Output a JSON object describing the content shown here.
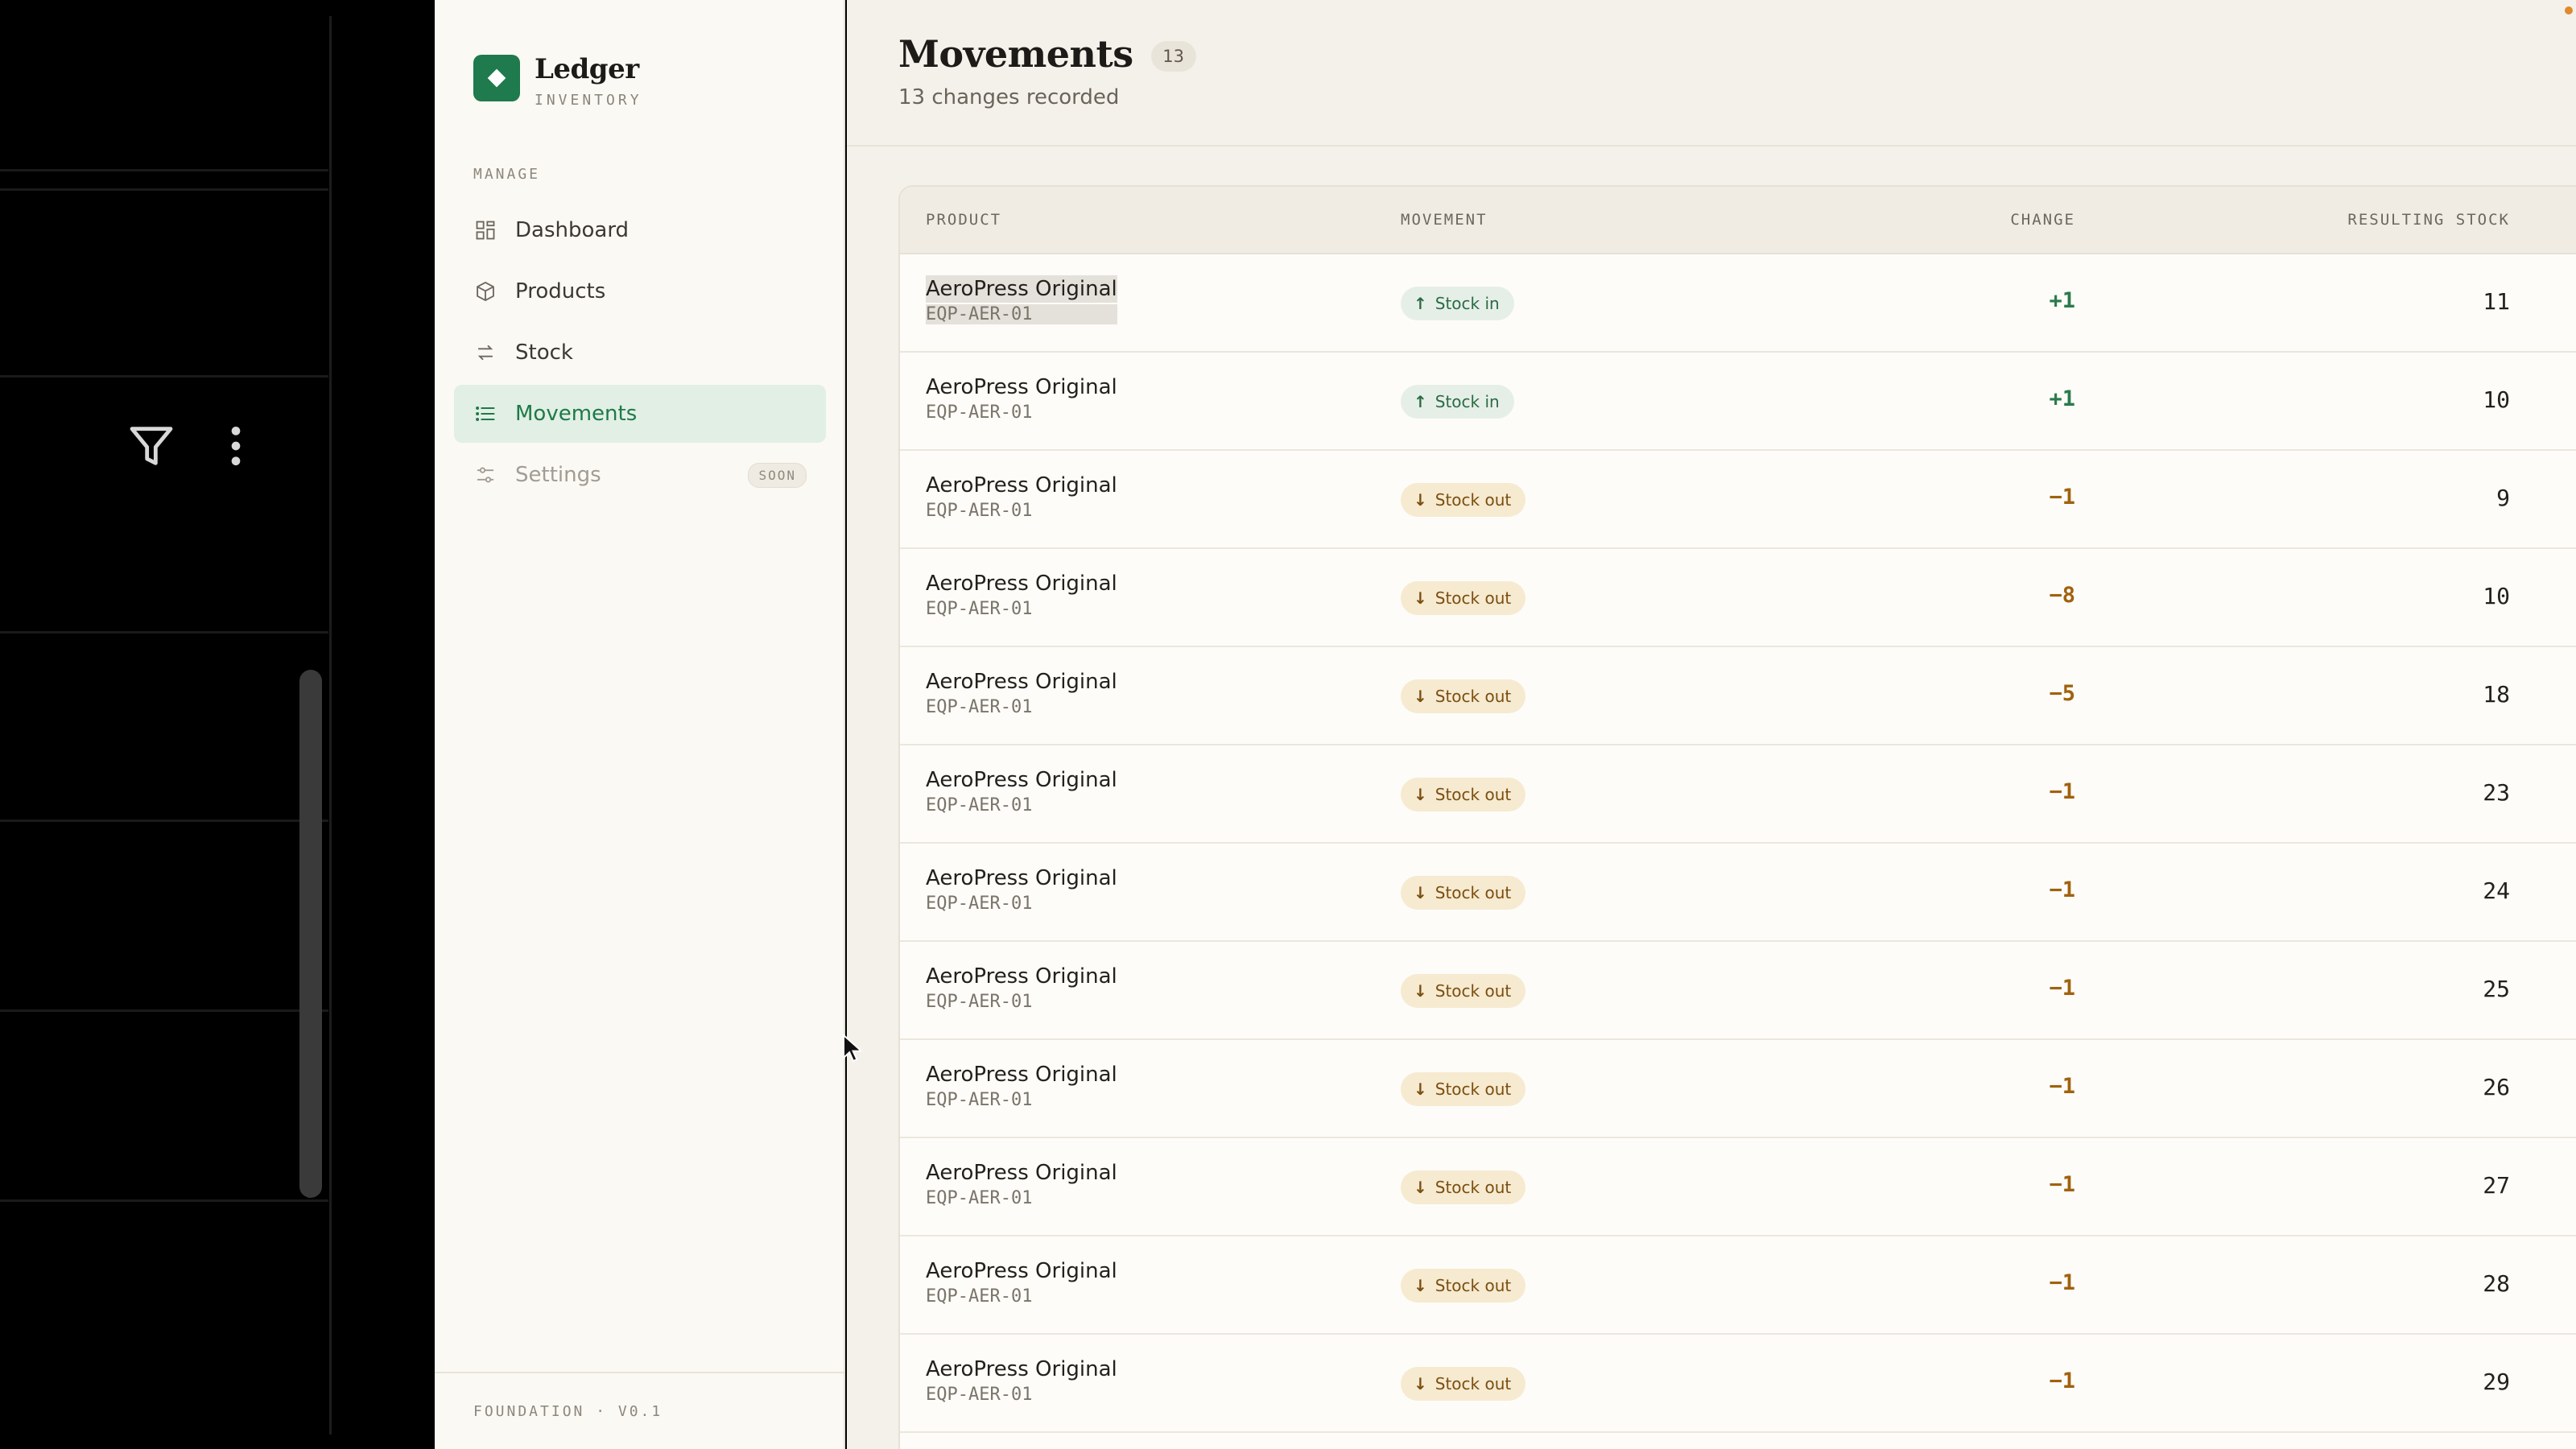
{
  "brand": {
    "name": "Ledger",
    "subtitle": "INVENTORY"
  },
  "sidebar": {
    "section_label": "MANAGE",
    "items": [
      {
        "label": "Dashboard",
        "icon": "grid-icon"
      },
      {
        "label": "Products",
        "icon": "box-icon"
      },
      {
        "label": "Stock",
        "icon": "arrows-icon"
      },
      {
        "label": "Movements",
        "icon": "list-icon",
        "active": true
      },
      {
        "label": "Settings",
        "icon": "sliders-icon",
        "badge": "SOON",
        "disabled": true
      }
    ],
    "footer": "FOUNDATION · V0.1"
  },
  "page": {
    "title": "Movements",
    "count": "13",
    "subtitle": "13 changes recorded"
  },
  "table": {
    "headers": {
      "product": "PRODUCT",
      "movement": "MOVEMENT",
      "change": "CHANGE",
      "resulting": "RESULTING STOCK"
    },
    "rows": [
      {
        "name": "AeroPress Original",
        "sku": "EQP-AER-01",
        "movement": "Stock in",
        "change": "+1",
        "resulting": "11"
      },
      {
        "name": "AeroPress Original",
        "sku": "EQP-AER-01",
        "movement": "Stock in",
        "change": "+1",
        "resulting": "10"
      },
      {
        "name": "AeroPress Original",
        "sku": "EQP-AER-01",
        "movement": "Stock out",
        "change": "−1",
        "resulting": "9"
      },
      {
        "name": "AeroPress Original",
        "sku": "EQP-AER-01",
        "movement": "Stock out",
        "change": "−8",
        "resulting": "10"
      },
      {
        "name": "AeroPress Original",
        "sku": "EQP-AER-01",
        "movement": "Stock out",
        "change": "−5",
        "resulting": "18"
      },
      {
        "name": "AeroPress Original",
        "sku": "EQP-AER-01",
        "movement": "Stock out",
        "change": "−1",
        "resulting": "23"
      },
      {
        "name": "AeroPress Original",
        "sku": "EQP-AER-01",
        "movement": "Stock out",
        "change": "−1",
        "resulting": "24"
      },
      {
        "name": "AeroPress Original",
        "sku": "EQP-AER-01",
        "movement": "Stock out",
        "change": "−1",
        "resulting": "25"
      },
      {
        "name": "AeroPress Original",
        "sku": "EQP-AER-01",
        "movement": "Stock out",
        "change": "−1",
        "resulting": "26"
      },
      {
        "name": "AeroPress Original",
        "sku": "EQP-AER-01",
        "movement": "Stock out",
        "change": "−1",
        "resulting": "27"
      },
      {
        "name": "AeroPress Original",
        "sku": "EQP-AER-01",
        "movement": "Stock out",
        "change": "−1",
        "resulting": "28"
      },
      {
        "name": "AeroPress Original",
        "sku": "EQP-AER-01",
        "movement": "Stock out",
        "change": "−1",
        "resulting": "29"
      }
    ]
  },
  "colors": {
    "accent": "#1f7a4d",
    "stock_in": "#2b7a4b",
    "stock_out": "#a0620e"
  }
}
